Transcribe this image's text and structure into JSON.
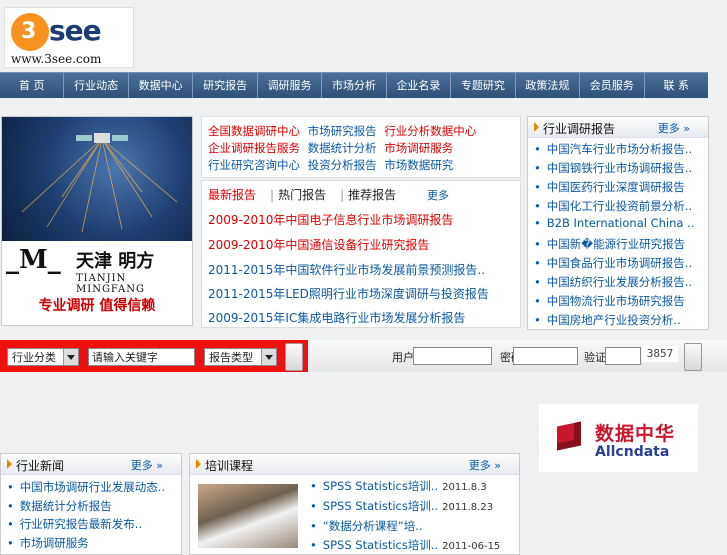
{
  "logo": {
    "mark": "3",
    "word": "see",
    "url": "www.3see.com"
  },
  "nav": [
    "首 页",
    "行业动态",
    "数据中心",
    "研究报告",
    "调研服务",
    "市场分析",
    "企业名录",
    "专题研究",
    "政策法规",
    "会员服务",
    "联 系"
  ],
  "banner": {
    "big": "_M_",
    "cn": "天津 明方",
    "en": "TIANJIN MINGFANG",
    "caption": "专业调研  值得信赖"
  },
  "notices": {
    "row1": [
      "全国数据调研中心",
      "市场研究报告",
      "行业分析数据中心"
    ],
    "row2": [
      "企业调研报告服务",
      "数据统计分析",
      "市场调研服务"
    ],
    "row3": [
      "行业研究咨询中心",
      "投资分析报告",
      "市场数据研究"
    ]
  },
  "news": {
    "tabs": [
      "最新报告",
      "热门报告",
      "推荐报告"
    ],
    "more": "更多",
    "items": [
      "2009-2010年中国电子信息行业市场调研报告",
      "2009-2010年中国通信设备行业研究报告",
      "2011-2015年中国软件行业市场发展前景预测报告..",
      "2011-2015年LED照明行业市场深度调研与投资报告",
      "2009-2015年IC集成电路行业市场发展分析报告"
    ]
  },
  "rightlist": {
    "title": "行业调研报告",
    "more": "更多 »",
    "items": [
      "中国汽车行业市场分析报告..",
      "中国钢铁行业市场调研报告..",
      "中国医药行业深度调研报告",
      "中国化工行业投资前景分析..",
      "B2B International China ..",
      "中国新�能源行业研究报告",
      "中国食品行业市场调研报告..",
      "中国纺织行业发展分析报告..",
      "中国物流行业市场研究报告",
      "中国房地产行业投资分析.."
    ]
  },
  "search": {
    "cat": "行业分类",
    "keyword": "请输入关键字",
    "type": "报告类型"
  },
  "login": {
    "user_label": "用户名",
    "pass_label": "密码",
    "code_label": "验证码",
    "captcha": "3857"
  },
  "ad": {
    "cn": "数据中华",
    "en": "Allcndata"
  },
  "box1": {
    "title": "行业新闻",
    "more": "更多 »",
    "items": [
      "中国市场调研行业发展动态..",
      "数据统计分析报告",
      "行业研究报告最新发布..",
      "市场调研服务"
    ]
  },
  "box2": {
    "title": "培训课程",
    "more": "更多 »",
    "items": [
      {
        "text": "SPSS Statistics培训..",
        "date": "2011.8.3"
      },
      {
        "text": "SPSS Statistics培训..",
        "date": "2011.8.23"
      },
      {
        "text": "“数据分析课程”培..",
        "date": ""
      },
      {
        "text": "SPSS Statistics培训..",
        "date": "2011-06-15"
      }
    ]
  }
}
